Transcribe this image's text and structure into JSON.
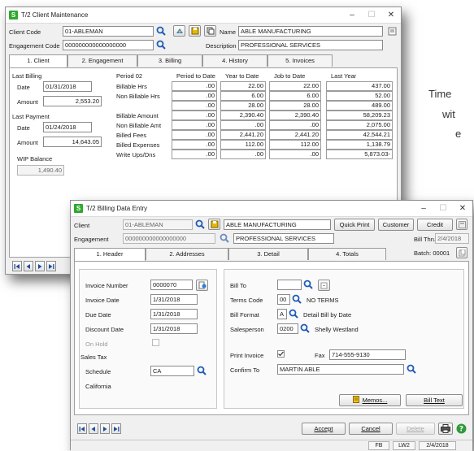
{
  "side_text": [
    "Time",
    "wit",
    "e"
  ],
  "maint": {
    "title": "T/2 Client Maintenance",
    "client_code_label": "Client Code",
    "client_code": "01-ABLEMAN",
    "engagement_code_label": "Engagement Code",
    "engagement_code": "000000000000000000",
    "name_label": "Name",
    "name": "ABLE MANUFACTURING",
    "description_label": "Description",
    "description": "PROFESSIONAL SERVICES",
    "tabs": [
      "1. Client",
      "2. Engagement",
      "3. Billing",
      "4. History",
      "5. Invoices"
    ],
    "last_billing_label": "Last Billing",
    "date_label": "Date",
    "billing_date": "01/31/2018",
    "amount_label": "Amount",
    "billing_amount": "2,553.20",
    "last_payment_label": "Last Payment",
    "payment_date": "01/24/2018",
    "payment_amount": "14,643.05",
    "wip_label": "WIP Balance",
    "wip_value": "1,490.40",
    "grid_headers": [
      "Period 02",
      "Period to Date",
      "Year to Date",
      "Job to Date",
      "Last Year"
    ],
    "grid_rows": [
      {
        "label": "Billable Hrs",
        "values": [
          ".00",
          "22.00",
          "22.00",
          "437.00"
        ]
      },
      {
        "label": "Non Billable Hrs",
        "values": [
          ".00",
          "6.00",
          "6.00",
          "52.00"
        ]
      },
      {
        "label": "",
        "values": [
          ".00",
          "28.00",
          "28.00",
          "489.00"
        ]
      },
      {
        "label": "Billable Amount",
        "values": [
          ".00",
          "2,390.40",
          "2,390.40",
          "58,209.23"
        ]
      },
      {
        "label": "Non Billable Amt",
        "values": [
          ".00",
          ".00",
          ".00",
          "2,075.00"
        ]
      },
      {
        "label": "Billed Fees",
        "values": [
          ".00",
          "2,441.20",
          "2,441.20",
          "42,544.21"
        ]
      },
      {
        "label": "Billed Expenses",
        "values": [
          ".00",
          "112.00",
          "112.00",
          "1,138.79"
        ]
      },
      {
        "label": "Write Ups/Dns",
        "values": [
          ".00",
          ".00",
          ".00",
          "5,873.03-"
        ]
      }
    ]
  },
  "entry": {
    "title": "T/2 Billing Data Entry",
    "client_label": "Client",
    "client": "01-ABLEMAN",
    "client_name": "ABLE MANUFACTURING",
    "quick_print": "Quick Print",
    "customer": "Customer",
    "credit": "Credit",
    "engagement_label": "Engagement",
    "engagement": "000000000000000000",
    "engagement_desc": "PROFESSIONAL SERVICES",
    "bill_thru_label": "Bill Thru",
    "bill_thru": "2/4/2018",
    "batch_label": "Batch: 00001",
    "tabs": [
      "1. Header",
      "2. Addresses",
      "3. Detail",
      "4. Totals"
    ],
    "invoice_number_label": "Invoice Number",
    "invoice_number": "0000070",
    "invoice_date_label": "Invoice Date",
    "invoice_date": "1/31/2018",
    "due_date_label": "Due Date",
    "due_date": "1/31/2018",
    "discount_date_label": "Discount Date",
    "discount_date": "1/31/2018",
    "on_hold_label": "On Hold",
    "sales_tax_label": "Sales Tax",
    "schedule_label": "Schedule",
    "schedule": "CA",
    "schedule_desc": "California",
    "bill_to_label": "Bill To",
    "bill_to": "",
    "terms_code_label": "Terms Code",
    "terms_code": "00",
    "terms_desc": "NO TERMS",
    "bill_format_label": "Bill Format",
    "bill_format": "A",
    "bill_format_desc": "Detail Bill by Date",
    "salesperson_label": "Salesperson",
    "salesperson": "0200",
    "salesperson_name": "Shelly Westland",
    "print_invoice_label": "Print Invoice",
    "fax_label": "Fax",
    "fax": "714-555-9130",
    "confirm_to_label": "Confirm To",
    "confirm_to": "MARTIN ABLE",
    "memos": "Memos...",
    "bill_text": "Bill Text",
    "accept": "Accept",
    "cancel": "Cancel",
    "delete": "Delete",
    "status": [
      "FB",
      "LW2",
      "2/4/2018"
    ]
  }
}
